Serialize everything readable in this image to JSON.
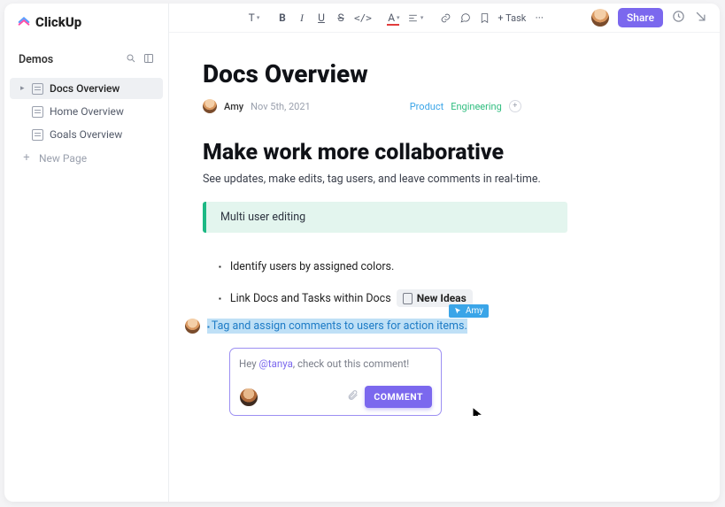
{
  "brand": "ClickUp",
  "sidebar": {
    "section": "Demos",
    "items": [
      {
        "label": "Docs Overview"
      },
      {
        "label": "Home Overview"
      },
      {
        "label": "Goals Overview"
      }
    ],
    "new_page": "New Page"
  },
  "toolbar": {
    "text_style": "T",
    "bold": "B",
    "italic": "I",
    "underline": "U",
    "strike": "S",
    "code": "</>",
    "textcolor": "A",
    "add_task": "+ Task",
    "more": "···",
    "share": "Share"
  },
  "doc": {
    "title": "Docs Overview",
    "author": "Amy",
    "date": "Nov 5th, 2021",
    "tags": {
      "product": "Product",
      "engineering": "Engineering"
    },
    "h2": "Make work more collaborative",
    "lead": "See updates, make edits, tag users, and leave comments in real-time.",
    "callout": "Multi user editing",
    "bullets": {
      "b1": "Identify users by assigned colors.",
      "b2": "Link Docs and Tasks within Docs",
      "b2_chip": "New Ideas",
      "b3": "Tag and assign comments to users for action items."
    },
    "presence_user": "Amy",
    "comment": {
      "text_pre": "Hey ",
      "mention": "@tanya",
      "text_post": ", check out this comment!",
      "button": "COMMENT"
    }
  }
}
